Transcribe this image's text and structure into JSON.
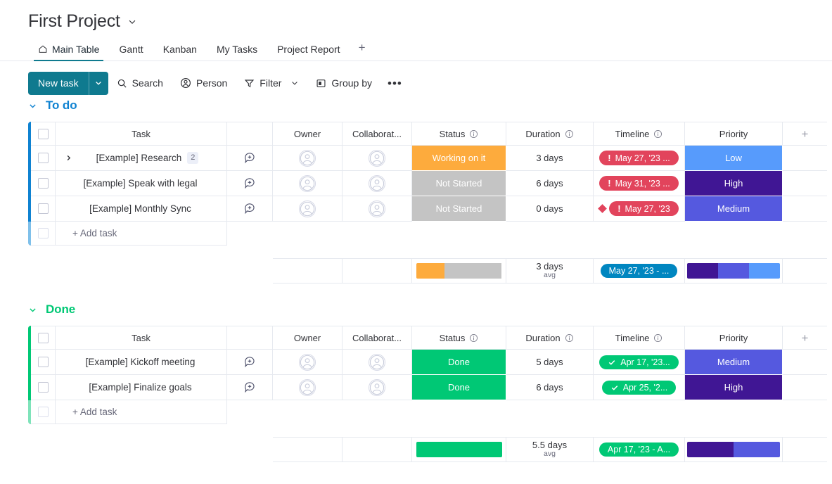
{
  "header": {
    "board_title": "First Project",
    "title_caret_icon": "chevron-down-icon"
  },
  "tabs": {
    "items": [
      {
        "label": "Main Table",
        "icon": "home-icon",
        "active": true
      },
      {
        "label": "Gantt",
        "icon": "",
        "active": false
      },
      {
        "label": "Kanban",
        "icon": "",
        "active": false
      },
      {
        "label": "My Tasks",
        "icon": "",
        "active": false
      },
      {
        "label": "Project Report",
        "icon": "",
        "active": false
      }
    ],
    "add_label": "+"
  },
  "toolbar": {
    "new_task_label": "New task",
    "new_task_caret_icon": "chevron-down-icon",
    "search_label": "Search",
    "person_label": "Person",
    "filter_label": "Filter",
    "group_by_label": "Group by",
    "more_label": "•••"
  },
  "columns": {
    "task": "Task",
    "owner": "Owner",
    "collaborators": "Collaborat...",
    "status": "Status",
    "duration": "Duration",
    "timeline": "Timeline",
    "priority": "Priority",
    "add_column": "+"
  },
  "colors": {
    "brand_teal": "#0f7a8f",
    "todo_accent": "#0f82d1",
    "done_accent": "#00c875",
    "status_working": "#fdab3d",
    "status_not_started": "#c4c4c4",
    "status_done": "#00c875",
    "priority_high": "#401694",
    "priority_medium": "#5559df",
    "priority_low": "#579bfc",
    "timeline_late": "#e2445c",
    "timeline_done": "#00c875",
    "timeline_summary_todo": "#0086c0",
    "timeline_summary_done": "#00c875"
  },
  "groups": [
    {
      "name": "To do",
      "color": "#0f82d1",
      "collapse_icon": "chevron-down-icon",
      "add_task_label": "+ Add task",
      "rows": [
        {
          "task": "[Example] Research",
          "subitem_count": "2",
          "has_expand": true,
          "status": "Working on it",
          "status_color": "#fdab3d",
          "duration": "3 days",
          "timeline": "May 27, '23 ...",
          "timeline_state": "late",
          "timeline_icon": "exclamation-icon",
          "milestone": false,
          "priority": "Low",
          "priority_color": "#579bfc"
        },
        {
          "task": "[Example] Speak with legal",
          "subitem_count": "",
          "has_expand": false,
          "status": "Not Started",
          "status_color": "#c4c4c4",
          "duration": "6 days",
          "timeline": "May 31, '23 ...",
          "timeline_state": "late",
          "timeline_icon": "exclamation-icon",
          "milestone": false,
          "priority": "High",
          "priority_color": "#401694"
        },
        {
          "task": "[Example] Monthly Sync",
          "subitem_count": "",
          "has_expand": false,
          "status": "Not Started",
          "status_color": "#c4c4c4",
          "duration": "0 days",
          "timeline": "May 27, '23",
          "timeline_state": "late",
          "timeline_icon": "exclamation-icon",
          "milestone": true,
          "priority": "Medium",
          "priority_color": "#5559df"
        }
      ],
      "summary": {
        "status_segments": [
          {
            "color": "#fdab3d",
            "pct": 33.3
          },
          {
            "color": "#c4c4c4",
            "pct": 66.7
          }
        ],
        "duration_value": "3 days",
        "duration_unit": "avg",
        "timeline_label": "May 27, '23 - ...",
        "timeline_color": "#0086c0",
        "priority_segments": [
          {
            "color": "#401694",
            "pct": 33.3
          },
          {
            "color": "#5559df",
            "pct": 33.3
          },
          {
            "color": "#579bfc",
            "pct": 33.4
          }
        ]
      }
    },
    {
      "name": "Done",
      "color": "#00c875",
      "collapse_icon": "chevron-down-icon",
      "add_task_label": "+ Add task",
      "rows": [
        {
          "task": "[Example] Kickoff meeting",
          "subitem_count": "",
          "has_expand": false,
          "status": "Done",
          "status_color": "#00c875",
          "duration": "5 days",
          "timeline": "Apr 17, '23...",
          "timeline_state": "done",
          "timeline_icon": "check-icon",
          "milestone": false,
          "priority": "Medium",
          "priority_color": "#5559df"
        },
        {
          "task": "[Example] Finalize goals",
          "subitem_count": "",
          "has_expand": false,
          "status": "Done",
          "status_color": "#00c875",
          "duration": "6 days",
          "timeline": "Apr 25, '2...",
          "timeline_state": "done",
          "timeline_icon": "check-icon",
          "milestone": false,
          "priority": "High",
          "priority_color": "#401694"
        }
      ],
      "summary": {
        "status_segments": [
          {
            "color": "#00c875",
            "pct": 100
          }
        ],
        "duration_value": "5.5 days",
        "duration_unit": "avg",
        "timeline_label": "Apr 17, '23 - A...",
        "timeline_color": "#00c875",
        "priority_segments": [
          {
            "color": "#401694",
            "pct": 50
          },
          {
            "color": "#5559df",
            "pct": 50
          }
        ]
      }
    }
  ]
}
